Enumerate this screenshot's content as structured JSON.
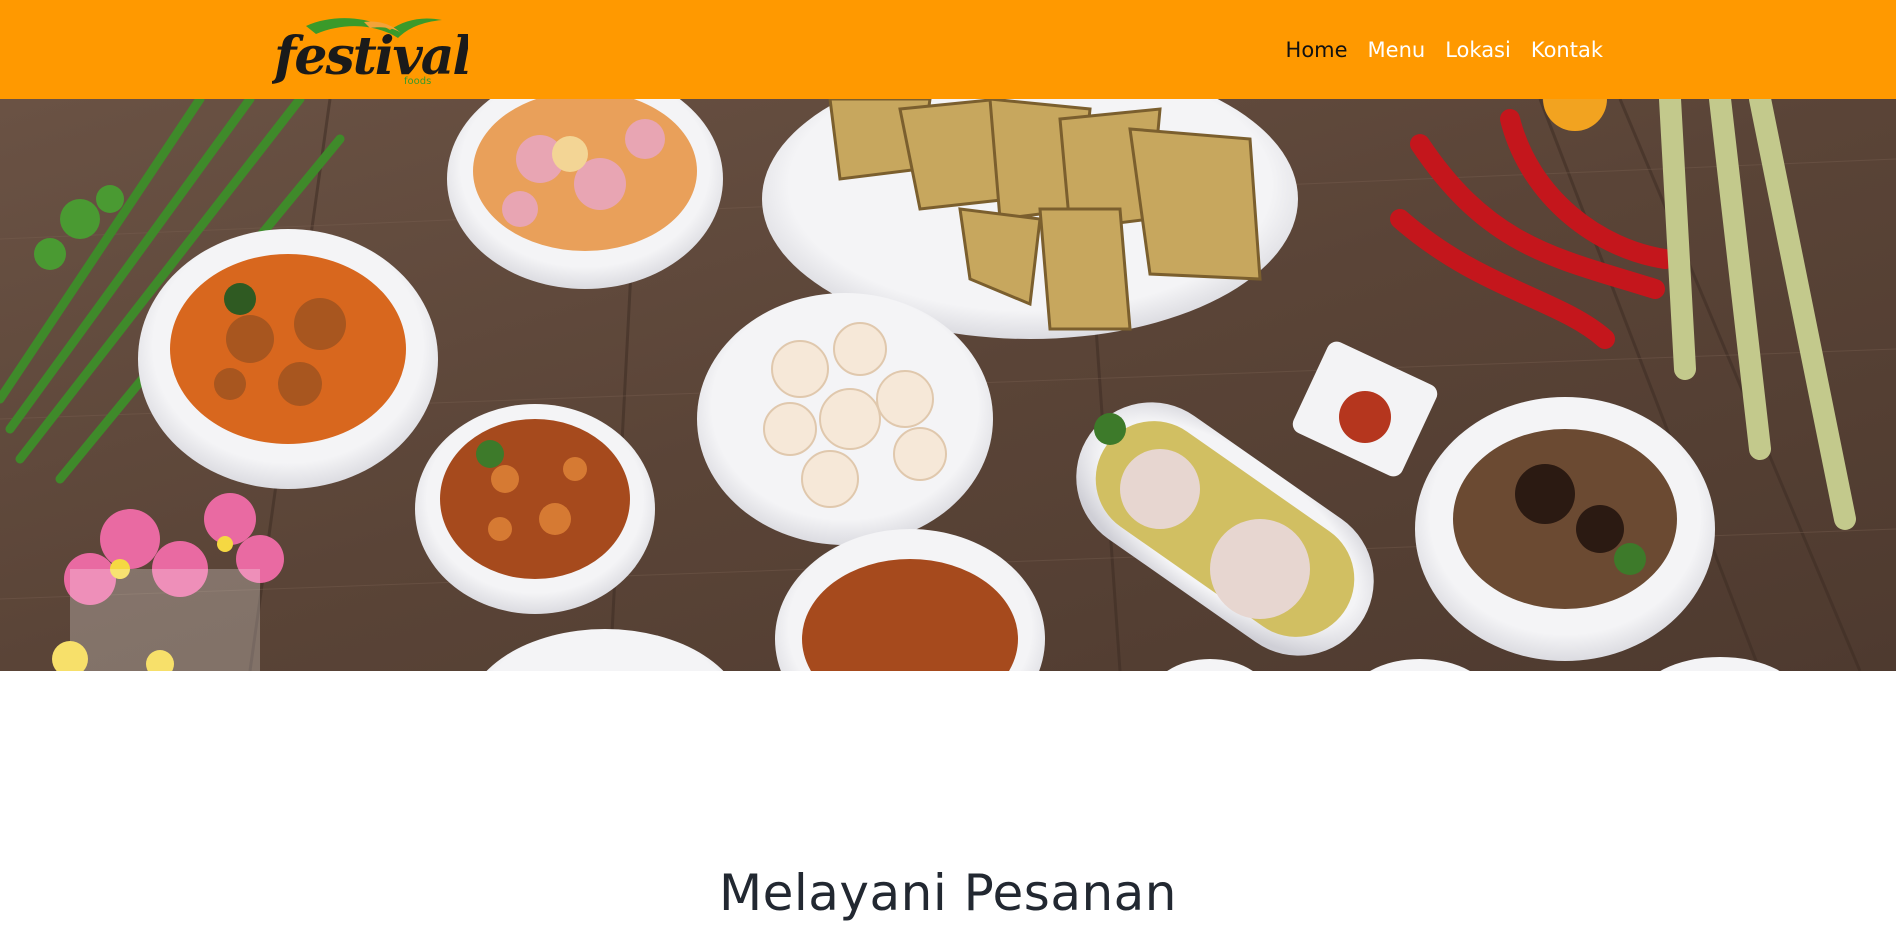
{
  "brand": {
    "logo_text": "festival",
    "logo_subtext": "foods",
    "colors": {
      "dark": "#1a1a1a",
      "green": "#3a9a2a",
      "orange": "#f2a33a"
    }
  },
  "header": {
    "background": "#ff9900",
    "nav": [
      {
        "label": "Home",
        "active": true
      },
      {
        "label": "Menu",
        "active": false
      },
      {
        "label": "Lokasi",
        "active": false
      },
      {
        "label": "Kontak",
        "active": false
      }
    ]
  },
  "hero": {
    "image": "indonesian-dishes-on-wooden-table"
  },
  "main": {
    "section_title": "Melayani Pesanan"
  }
}
